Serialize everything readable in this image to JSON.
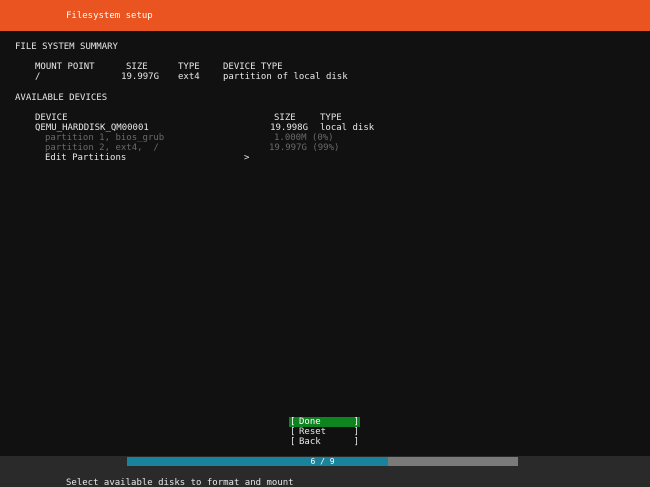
{
  "header": {
    "title": "Filesystem setup"
  },
  "summary": {
    "heading": "FILE SYSTEM SUMMARY",
    "columns": {
      "mount_point": "MOUNT POINT",
      "size": "SIZE",
      "type": "TYPE",
      "device_type": "DEVICE TYPE"
    },
    "rows": [
      {
        "mount_point": "/",
        "size": "19.997G",
        "type": "ext4",
        "device_type": "partition of local disk"
      }
    ]
  },
  "devices": {
    "heading": "AVAILABLE DEVICES",
    "columns": {
      "device": "DEVICE",
      "size": "SIZE",
      "type": "TYPE"
    },
    "disk": {
      "name": "QEMU_HARDDISK_QM00001",
      "size": "19.998G",
      "type": "local disk"
    },
    "partitions": [
      {
        "label": "partition 1, bios_grub",
        "size": "1.000M (0%)"
      },
      {
        "label": "partition 2, ext4,  /",
        "size": "19.997G (99%)"
      }
    ],
    "edit_label": "Edit Partitions",
    "edit_arrow": ">"
  },
  "buttons": [
    {
      "label": "Done",
      "focused": true
    },
    {
      "label": "Reset",
      "focused": false
    },
    {
      "label": "Back",
      "focused": false
    }
  ],
  "bracket_open": "[",
  "bracket_close": "]",
  "progress": {
    "text": "6 / 9",
    "current": 6,
    "total": 9
  },
  "status": {
    "text": "Select available disks to format and mount"
  },
  "colors": {
    "header": "#e95420",
    "background": "#111111",
    "focus": "#0e8420",
    "progress_fill": "#19839b",
    "progress_track": "#7a7a7a"
  }
}
